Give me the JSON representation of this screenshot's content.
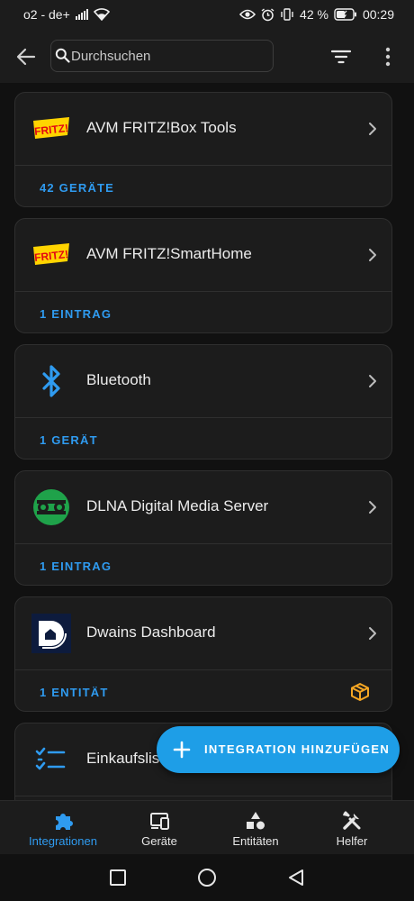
{
  "status_bar": {
    "carrier": "o2 - de+",
    "battery": "42 %",
    "time": "00:29"
  },
  "app_bar": {
    "search_placeholder": "Durchsuchen"
  },
  "integrations": [
    {
      "title": "AVM FRITZ!Box Tools",
      "link": "42 GERÄTE",
      "logo": "fritz-logo"
    },
    {
      "title": "AVM FRITZ!SmartHome",
      "link": "1 EINTRAG",
      "logo": "fritz-logo"
    },
    {
      "title": "Bluetooth",
      "link": "1 GERÄT",
      "logo": "bluetooth-logo"
    },
    {
      "title": "DLNA Digital Media Server",
      "link": "1 EINTRAG",
      "logo": "dlna-logo"
    },
    {
      "title": "Dwains Dashboard",
      "link": "1 ENTITÄT",
      "logo": "dwains-logo",
      "badge": "custom-integration-icon"
    },
    {
      "title": "Einkaufsliste",
      "logo": "shopping-list-logo"
    }
  ],
  "fab": {
    "label": "INTEGRATION HINZUFÜGEN"
  },
  "bottom_nav": {
    "items": [
      {
        "label": "Integrationen",
        "icon": "puzzle-icon",
        "active": true
      },
      {
        "label": "Geräte",
        "icon": "devices-icon"
      },
      {
        "label": "Entitäten",
        "icon": "shapes-icon"
      },
      {
        "label": "Helfer",
        "icon": "tools-icon"
      }
    ]
  },
  "colors": {
    "background": "#111111",
    "card": "#1c1c1c",
    "accent": "#2f9bf0",
    "fab": "#1e9ee7",
    "fritz_red": "#e30613",
    "fritz_yellow": "#ffd400",
    "dlna_green": "#1fa24a",
    "badge_orange": "#f5a623"
  }
}
